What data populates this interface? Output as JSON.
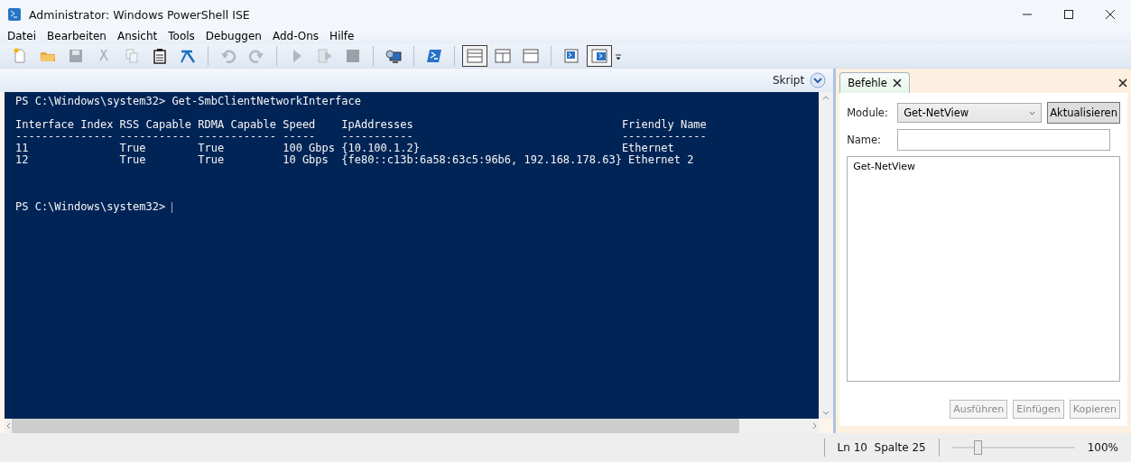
{
  "window": {
    "title": "Administrator: Windows PowerShell ISE"
  },
  "menu": [
    "Datei",
    "Bearbeiten",
    "Ansicht",
    "Tools",
    "Debuggen",
    "Add-Ons",
    "Hilfe"
  ],
  "toolbar": [
    {
      "kind": "new",
      "disabled": false,
      "selected": false
    },
    {
      "kind": "open",
      "disabled": false,
      "selected": false
    },
    {
      "kind": "save",
      "disabled": true,
      "selected": false
    },
    {
      "kind": "cut",
      "disabled": true,
      "selected": false
    },
    {
      "kind": "copy",
      "disabled": true,
      "selected": false
    },
    {
      "kind": "paste",
      "disabled": false,
      "selected": false
    },
    {
      "kind": "clear",
      "disabled": false,
      "selected": false
    },
    {
      "kind": "separator"
    },
    {
      "kind": "undo",
      "disabled": true,
      "selected": false
    },
    {
      "kind": "redo",
      "disabled": true,
      "selected": false
    },
    {
      "kind": "separator"
    },
    {
      "kind": "run",
      "disabled": true,
      "selected": false
    },
    {
      "kind": "runselection",
      "disabled": true,
      "selected": false
    },
    {
      "kind": "stop",
      "disabled": true,
      "selected": false
    },
    {
      "kind": "separator"
    },
    {
      "kind": "remote",
      "disabled": false,
      "selected": false
    },
    {
      "kind": "separator"
    },
    {
      "kind": "powershell",
      "disabled": false,
      "selected": false
    },
    {
      "kind": "separator"
    },
    {
      "kind": "paneltop",
      "disabled": false,
      "selected": true
    },
    {
      "kind": "panelright",
      "disabled": false,
      "selected": false
    },
    {
      "kind": "panelmax",
      "disabled": false,
      "selected": false
    },
    {
      "kind": "separator"
    },
    {
      "kind": "scriptpane",
      "disabled": false,
      "selected": false
    },
    {
      "kind": "commandpane",
      "disabled": false,
      "selected": true
    }
  ],
  "script_bar": {
    "label": "Skript"
  },
  "console": {
    "blocks": [
      {
        "kind": "command",
        "lines": [
          "PS C:\\Windows\\system32> Get-SmbClientNetworkInterface"
        ]
      },
      {
        "kind": "output",
        "lines": [
          "Interface Index RSS Capable RDMA Capable Speed    IpAddresses                                Friendly Name",
          "--------------- ----------- ------------ -----    -----------                                -------------",
          "11              True        True         100 Gbps {10.100.1.2}                               Ethernet",
          "12              True        True         10 Gbps  {fe80::c13b:6a58:63c5:96b6, 192.168.178.63} Ethernet 2"
        ]
      },
      {
        "kind": "prompt",
        "lines": [
          "PS C:\\Windows\\system32> "
        ]
      }
    ],
    "cursor_visible": true
  },
  "commands_pane": {
    "tab": "Befehle",
    "module_label": "Module:",
    "module_value": "Get-NetView",
    "refresh": "Aktualisieren",
    "name_label": "Name:",
    "list": [
      "Get-NetView"
    ],
    "buttons": [
      "Ausführen",
      "Einfügen",
      "Kopieren"
    ]
  },
  "status_bar": {
    "position": "Ln 10  Spalte 25",
    "zoom": "100%",
    "slider": {
      "level": 0.18
    }
  }
}
